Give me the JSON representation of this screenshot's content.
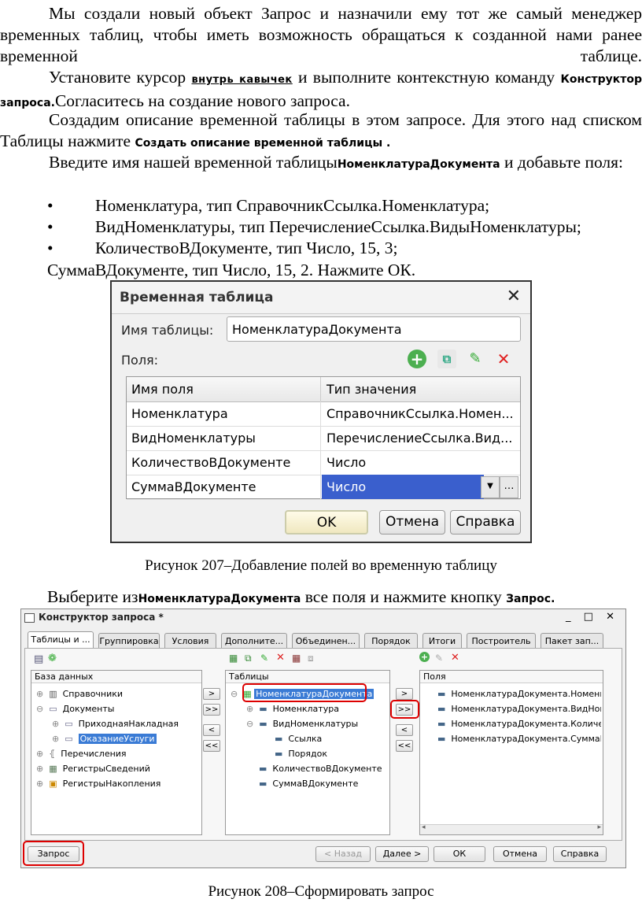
{
  "para1": "Мы создали новый объект Запрос и назначили ему тот же самый менеджер временных таблиц, чтобы иметь возможность обращаться к созданной нами ранее временной таблице.",
  "para2": {
    "pre": "Установите курсор ",
    "u": "внутрь кавычек",
    "mid": " и выполните контекстную команду ",
    "b": "Конструктор запроса.",
    "post": "Согласитесь на создание нового запроса."
  },
  "para3": {
    "pre": "Создадим описание временной таблицы в этом запросе. Для этого над списком Таблицы нажмите ",
    "b": "Создать описание временной таблицы ."
  },
  "para4": {
    "pre": "Введите имя нашей временной таблицы",
    "b": "НоменклатураДокумента",
    "post": " и добавьте поля:"
  },
  "bullets": [
    "Номенклатура, тип СправочникСсылка.Номенклатура;",
    "ВидНоменклатуры, тип ПеречислениеСсылка.ВидыНоменклатуры;",
    "КоличествоВДокументе, тип Число, 15, 3;"
  ],
  "para5": "СуммаВДокументе, тип Число, 15, 2. Нажмите ОК.",
  "dialog1": {
    "title": "Временная таблица",
    "close": "✕",
    "name_label": "Имя таблицы:",
    "name_value": "НоменклатураДокумента",
    "fields_label": "Поля:",
    "col_name": "Имя поля",
    "col_type": "Тип значения",
    "rows": [
      {
        "name": "Номенклатура",
        "type": "СправочникСсылка.Номен..."
      },
      {
        "name": "ВидНоменклатуры",
        "type": "ПеречислениеСсылка.Вид..."
      },
      {
        "name": "КоличествоВДокументе",
        "type": "Число"
      },
      {
        "name": "СуммаВДокументе",
        "type": "Число"
      }
    ],
    "ok": "OK",
    "cancel": "Отмена",
    "help": "Справка",
    "accent": "#3a5fcd"
  },
  "caption1": "Рисунок 207–Добавление полей во временную таблицу",
  "para6": {
    "pre": "Выберите из",
    "b": "НоменклатураДокумента",
    "mid": " все поля и нажмите кнопку ",
    "b2": "Запрос."
  },
  "dialog2": {
    "title": "Конструктор запроса *",
    "controls": "_ □ ✕",
    "tabs": [
      "Таблицы и ...",
      "Группировка",
      "Условия",
      "Дополните...",
      "Объединен...",
      "Порядок",
      "Итоги",
      "Построитель",
      "Пакет зап..."
    ],
    "db_header": "База данных",
    "tables_header": "Таблицы",
    "fields_header": "Поля",
    "db_tree": [
      "Справочники",
      "Документы",
      "ПриходнаяНакладная",
      "ОказаниеУслуги",
      "Перечисления",
      "РегистрыСведений",
      "РегистрыНакопления"
    ],
    "tables_tree": [
      "НоменклатураДокумента",
      "Номенклатура",
      "ВидНоменклатуры",
      "Ссылка",
      "Порядок",
      "КоличествоВДокументе",
      "СуммаВДокументе"
    ],
    "fields": [
      "НоменклатураДокумента.Номенклат",
      "НоменклатураДокумента.ВидНомен",
      "НоменклатураДокумента.Количеств",
      "НоменклатураДокумента.СуммаВДо"
    ],
    "move": [
      ">",
      ">>",
      "<",
      "<<"
    ],
    "btn_query": "Запрос",
    "btn_back": "< Назад",
    "btn_next": "Далее >",
    "btn_ok": "ОК",
    "btn_cancel": "Отмена",
    "btn_help": "Справка"
  },
  "caption2": "Рисунок 208–Сформировать запрос"
}
